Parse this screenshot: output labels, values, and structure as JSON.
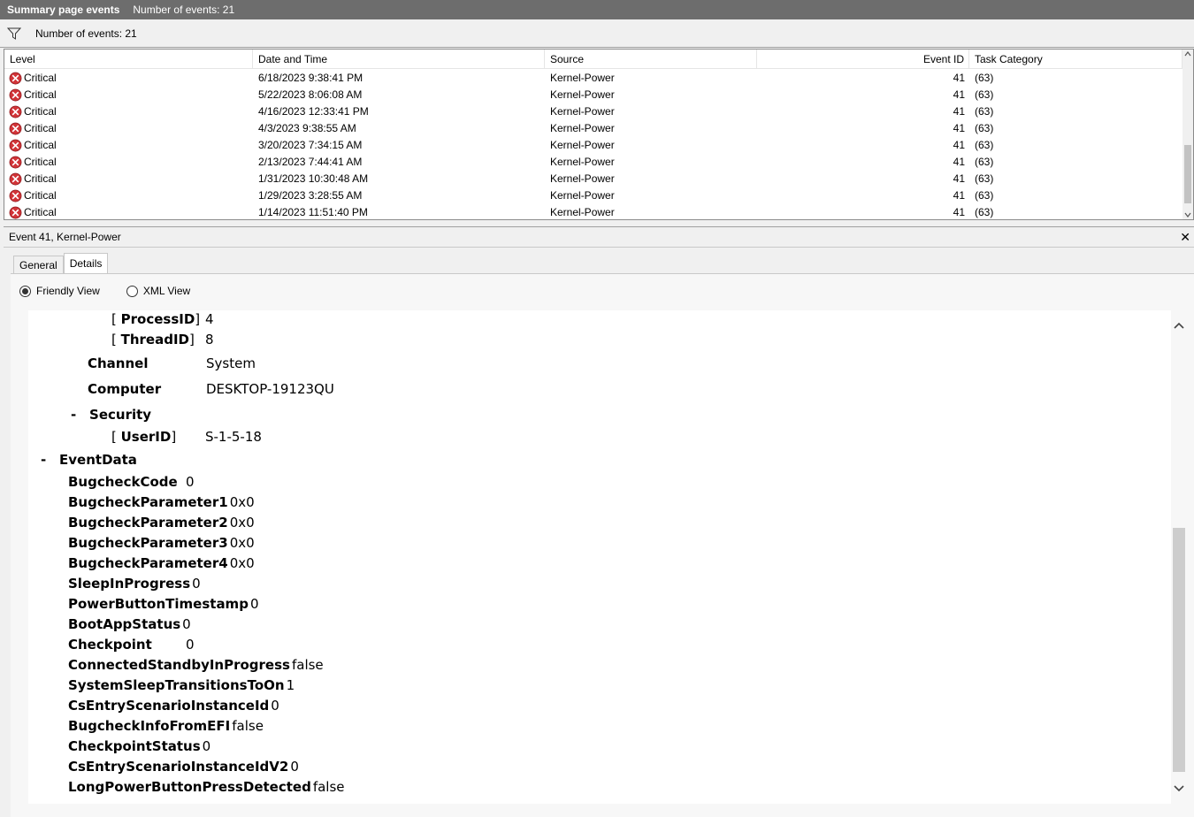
{
  "titlebar": {
    "title": "Summary page events",
    "count": "Number of events: 21"
  },
  "filterbar": {
    "count": "Number of events: 21"
  },
  "columns": {
    "level": "Level",
    "date": "Date and Time",
    "source": "Source",
    "event_id": "Event ID",
    "task": "Task Category"
  },
  "events": [
    {
      "level": "Critical",
      "date": "6/18/2023 9:38:41 PM",
      "source": "Kernel-Power",
      "id": "41",
      "task": "(63)"
    },
    {
      "level": "Critical",
      "date": "5/22/2023 8:06:08 AM",
      "source": "Kernel-Power",
      "id": "41",
      "task": "(63)"
    },
    {
      "level": "Critical",
      "date": "4/16/2023 12:33:41 PM",
      "source": "Kernel-Power",
      "id": "41",
      "task": "(63)"
    },
    {
      "level": "Critical",
      "date": "4/3/2023 9:38:55 AM",
      "source": "Kernel-Power",
      "id": "41",
      "task": "(63)"
    },
    {
      "level": "Critical",
      "date": "3/20/2023 7:34:15 AM",
      "source": "Kernel-Power",
      "id": "41",
      "task": "(63)"
    },
    {
      "level": "Critical",
      "date": "2/13/2023 7:44:41 AM",
      "source": "Kernel-Power",
      "id": "41",
      "task": "(63)"
    },
    {
      "level": "Critical",
      "date": "1/31/2023 10:30:48 AM",
      "source": "Kernel-Power",
      "id": "41",
      "task": "(63)"
    },
    {
      "level": "Critical",
      "date": "1/29/2023 3:28:55 AM",
      "source": "Kernel-Power",
      "id": "41",
      "task": "(63)"
    },
    {
      "level": "Critical",
      "date": "1/14/2023 11:51:40 PM",
      "source": "Kernel-Power",
      "id": "41",
      "task": "(63)"
    }
  ],
  "detail": {
    "title": "Event 41, Kernel-Power",
    "close": "✕"
  },
  "tabs": {
    "general": "General",
    "details": "Details"
  },
  "view": {
    "friendly": "Friendly View",
    "xml": "XML View"
  },
  "tree": {
    "processid": {
      "open": "[ ",
      "key": "ProcessID",
      "close": "]",
      "value": "4"
    },
    "threadid": {
      "open": "[ ",
      "key": "ThreadID",
      "close": "]",
      "value": "8"
    },
    "channel": {
      "key": "Channel",
      "value": "System"
    },
    "computer": {
      "key": "Computer",
      "value": "DESKTOP-19123QU"
    },
    "security": {
      "toggle": "-",
      "key": "Security"
    },
    "userid": {
      "open": "[ ",
      "key": "UserID",
      "close": "]",
      "value": "S-1-5-18"
    },
    "eventdata": {
      "toggle": "-",
      "key": "EventData"
    },
    "fields": [
      {
        "key": "BugcheckCode",
        "value": "0"
      },
      {
        "key": "BugcheckParameter1",
        "value": "0x0"
      },
      {
        "key": "BugcheckParameter2",
        "value": "0x0"
      },
      {
        "key": "BugcheckParameter3",
        "value": "0x0"
      },
      {
        "key": "BugcheckParameter4",
        "value": "0x0"
      },
      {
        "key": "SleepInProgress",
        "value": "0"
      },
      {
        "key": "PowerButtonTimestamp",
        "value": "0"
      },
      {
        "key": "BootAppStatus",
        "value": "0"
      },
      {
        "key": "Checkpoint",
        "value": "0"
      },
      {
        "key": "ConnectedStandbyInProgress",
        "value": "false"
      },
      {
        "key": "SystemSleepTransitionsToOn",
        "value": "1"
      },
      {
        "key": "CsEntryScenarioInstanceId",
        "value": "0"
      },
      {
        "key": "BugcheckInfoFromEFI",
        "value": "false"
      },
      {
        "key": "CheckpointStatus",
        "value": "0"
      },
      {
        "key": "CsEntryScenarioInstanceIdV2",
        "value": "0"
      },
      {
        "key": "LongPowerButtonPressDetected",
        "value": "false"
      }
    ]
  }
}
